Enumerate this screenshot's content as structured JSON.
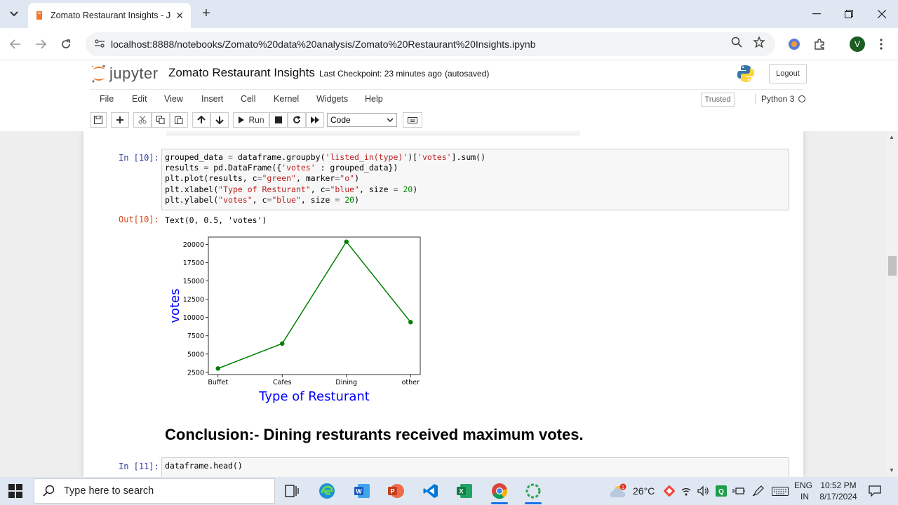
{
  "browser": {
    "tab_title": "Zomato Restaurant Insights - Ju",
    "url": "localhost:8888/notebooks/Zomato%20data%20analysis/Zomato%20Restaurant%20Insights.ipynb",
    "avatar_letter": "V"
  },
  "jupyter": {
    "logo_text": "jupyter",
    "notebook_title": "Zomato Restaurant Insights",
    "checkpoint": "Last Checkpoint: 23 minutes ago",
    "autosave": "(autosaved)",
    "logout_label": "Logout",
    "menu": [
      "File",
      "Edit",
      "View",
      "Insert",
      "Cell",
      "Kernel",
      "Widgets",
      "Help"
    ],
    "trusted_label": "Trusted",
    "kernel_label": "Python 3",
    "run_label": "Run",
    "cell_type": "Code"
  },
  "cells": {
    "in10_prompt": "In [10]:",
    "out10_prompt": "Out[10]:",
    "out10_text": "Text(0, 0.5, 'votes')",
    "conclusion": "Conclusion:- Dining resturants received maximum votes.",
    "in11_prompt": "In [11]:",
    "in11_code": "dataframe.head()"
  },
  "chart_data": {
    "type": "line",
    "categories": [
      "Buffet",
      "Cafes",
      "Dining",
      "other"
    ],
    "values": [
      3028,
      6434,
      20363,
      9367
    ],
    "xlabel": "Type of Resturant",
    "ylabel": "votes",
    "ylim": [
      2200,
      21000
    ],
    "yticks": [
      2500,
      5000,
      7500,
      10000,
      12500,
      15000,
      17500,
      20000
    ],
    "line_color": "#008000",
    "label_color": "#0000ff",
    "marker": "o",
    "grid": false
  },
  "taskbar": {
    "search_placeholder": "Type here to search",
    "temperature": "26°C",
    "language": "ENG",
    "region": "IN",
    "time": "10:52 PM",
    "date": "8/17/2024",
    "weather_badge": "1"
  }
}
